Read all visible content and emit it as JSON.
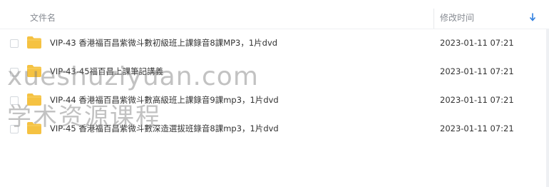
{
  "columns": {
    "name": "文件名",
    "modified": "修改时间",
    "sort_icon": "arrow-down-icon"
  },
  "files": [
    {
      "name": "VIP-43 香港福百昌紫微斗數初級班上課錄音8課MP3，1片dvd",
      "modified": "2023-01-11 07:21",
      "icon": "folder-icon"
    },
    {
      "name": "VIP-43-45福百昌上課筆記講義",
      "modified": "2023-01-11 07:21",
      "icon": "folder-icon"
    },
    {
      "name": "VIP-44 香港福百昌紫微斗數高級班上課錄音9課mp3，1片dvd",
      "modified": "2023-01-11 07:21",
      "icon": "folder-icon"
    },
    {
      "name": "VIP-45 香港福百昌紫微斗數深造選拔班錄音8課mp3，1片dvd",
      "modified": "2023-01-11 07:21",
      "icon": "folder-icon"
    }
  ],
  "watermark": {
    "line1": "xueshuziyuan.com",
    "line2": "学术资源课程"
  },
  "colors": {
    "folder": "#f5c242",
    "sort_arrow": "#2f7fe0",
    "header_text": "#888c93"
  }
}
